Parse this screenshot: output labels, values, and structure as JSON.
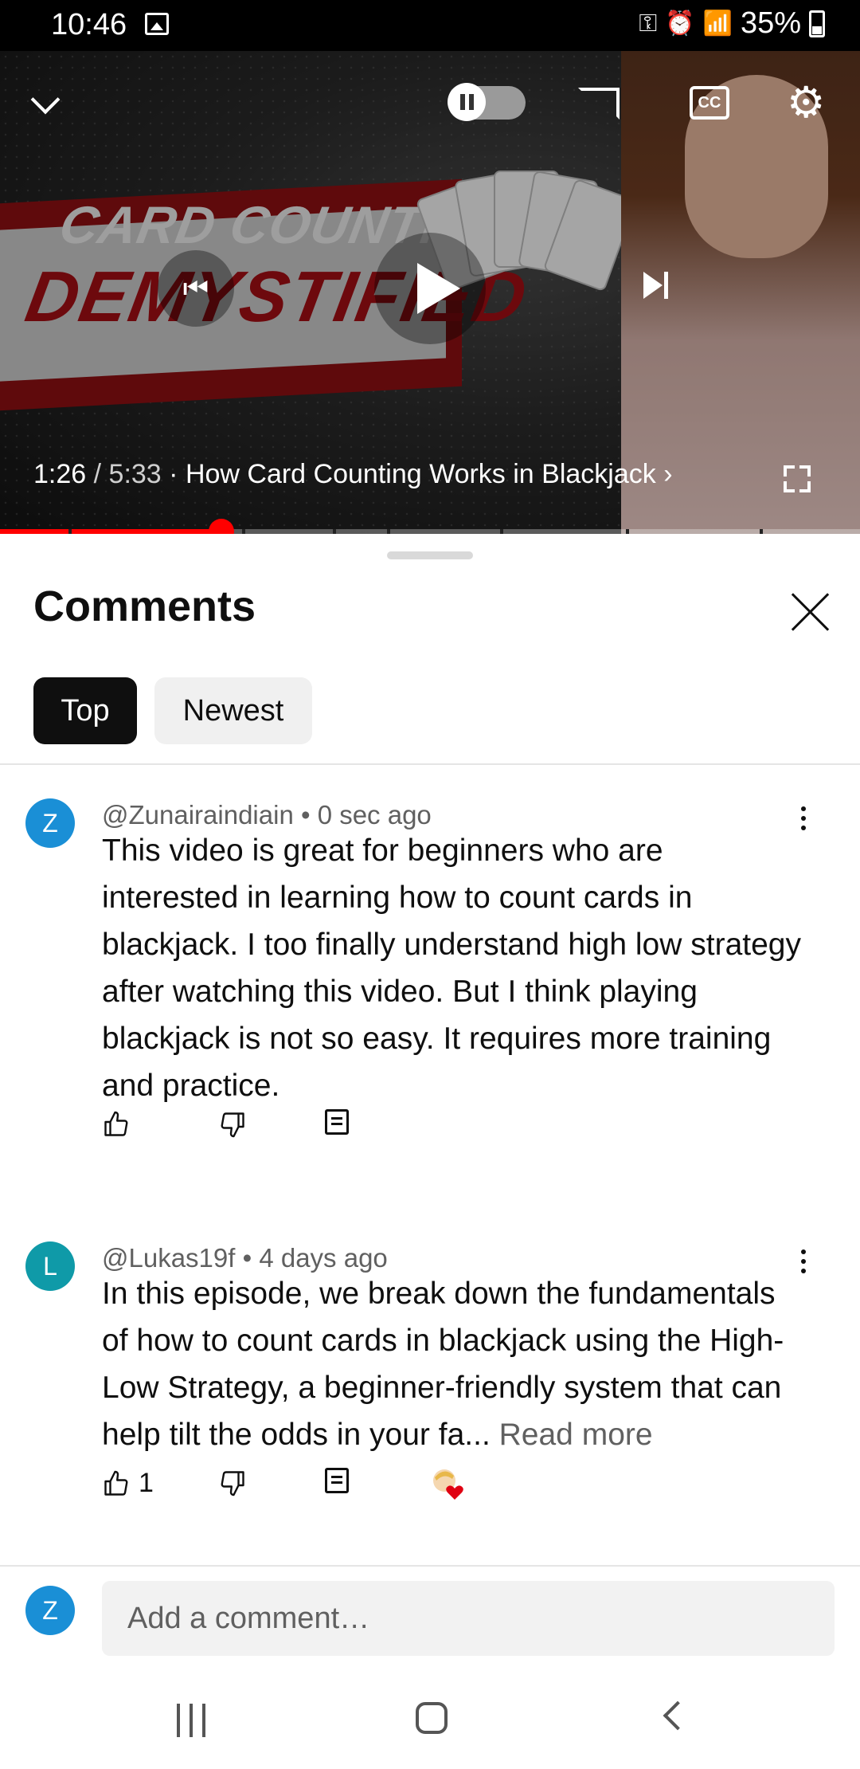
{
  "status_bar": {
    "time": "10:46",
    "battery": "35%",
    "icons": [
      "image-icon",
      "key-icon",
      "alarm-icon",
      "wifi-icon",
      "signal-icon",
      "battery-icon"
    ]
  },
  "video": {
    "thumbnail_text_line1": "CARD COUNTING",
    "thumbnail_text_line2": "DEMYSTIFIED",
    "current_time": "1:26",
    "separator": " / ",
    "duration": "5:33",
    "title": "How Card Counting Works in Blackjack",
    "title_prefix": " · ",
    "title_suffix": " ›",
    "progress": 0.257,
    "autoplay": "on",
    "cc_label": "CC",
    "accent_color": "#ff0000"
  },
  "comments_sheet": {
    "title": "Comments",
    "tabs": [
      {
        "label": "Top",
        "selected": true
      },
      {
        "label": "Newest",
        "selected": false
      }
    ],
    "comments": [
      {
        "avatar_letter": "Z",
        "avatar_color": "#1a8fd6",
        "author": "@Zunairaindiain",
        "age": "0 sec ago",
        "text": "This video is great for beginners who are interested in learning how to count cards in blackjack. I too finally understand high low strategy after watching this video.  But I think playing blackjack is not so easy. It requires more training and practice.",
        "likes": "",
        "read_more": ""
      },
      {
        "avatar_letter": "L",
        "avatar_color": "#0f9aa8",
        "author": "@Lukas19f",
        "age": "4 days ago",
        "text": "In this episode, we break down the fundamentals of how to count cards in blackjack using the High-Low Strategy, a beginner-friendly system that can help tilt the odds in your fa...",
        "likes": "1",
        "read_more": " Read more",
        "creator_heart": true
      }
    ],
    "meta_separator": " • ",
    "add_comment": {
      "avatar_letter": "Z",
      "avatar_color": "#1a8fd6",
      "placeholder": "Add a comment…"
    }
  }
}
